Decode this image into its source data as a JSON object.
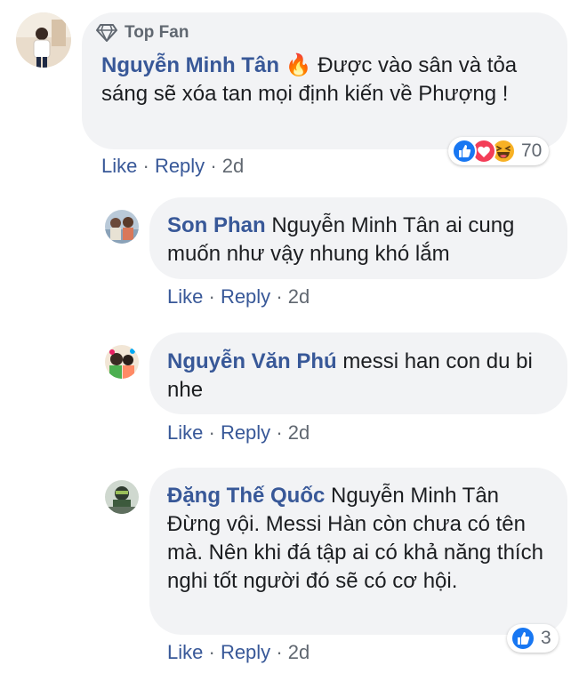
{
  "top_comment": {
    "badge_label": "Top Fan",
    "author": "Nguyễn Minh Tân",
    "emoji": "🔥",
    "text": "Được vào sân và tỏa sáng sẽ xóa tan mọi định kiến về Phượng !",
    "reaction_count": "70",
    "reaction_icons": [
      "like-icon",
      "love-icon",
      "haha-icon"
    ],
    "like_label": "Like",
    "reply_label": "Reply",
    "time": "2d"
  },
  "replies": [
    {
      "author": "Son Phan",
      "text": "Nguyễn Minh Tân ai cung muốn như vậy nhung khó lắm",
      "like_label": "Like",
      "reply_label": "Reply",
      "time": "2d"
    },
    {
      "author": "Nguyễn Văn Phú",
      "text": "messi han con du bi nhe",
      "like_label": "Like",
      "reply_label": "Reply",
      "time": "2d"
    },
    {
      "author": "Đặng Thế Quốc",
      "text": "Nguyễn Minh Tân Đừng vội. Messi Hàn còn chưa có tên mà. Nên khi đá tập ai có khả năng thích nghi tốt người đó sẽ có cơ hội.",
      "reaction_count": "3",
      "reaction_icons": [
        "like-icon"
      ],
      "like_label": "Like",
      "reply_label": "Reply",
      "time": "2d"
    }
  ],
  "separator": "·",
  "colors": {
    "name_link": "#385898",
    "bubble_bg": "#f2f3f5",
    "meta_gray": "#606770",
    "like_blue": "#1877f2",
    "love_red": "#f33e58",
    "haha_yellow": "#f7b125"
  }
}
